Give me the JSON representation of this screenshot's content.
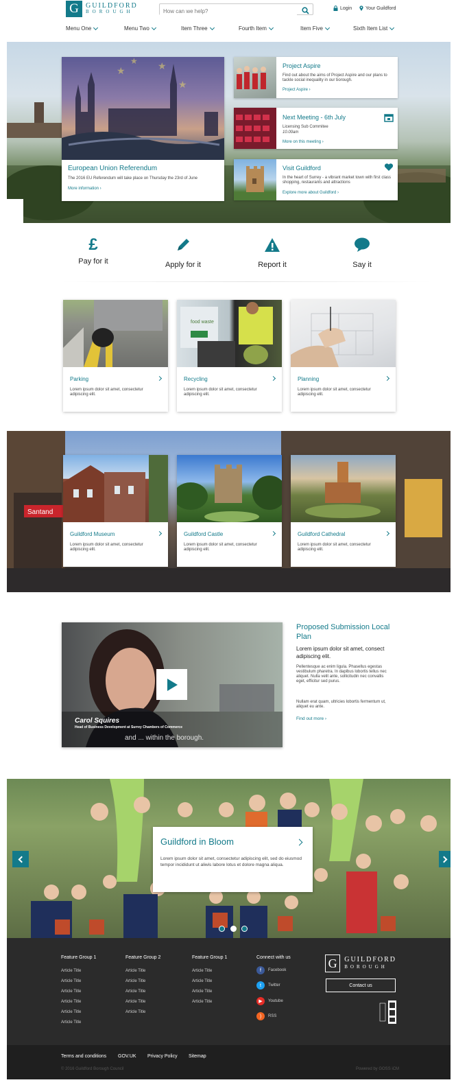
{
  "header": {
    "logo": {
      "line1": "GUILDFORD",
      "line2": "BOROUGH",
      "mark": "G"
    },
    "search_placeholder": "How can we help?",
    "login": "Login",
    "your_guildford": "Your Guildford"
  },
  "nav": [
    "Menu One",
    "Menu Two",
    "Item Three",
    "Fourth Item",
    "Item Five",
    "Sixth Item List"
  ],
  "hero": {
    "main": {
      "title": "European Union Referendum",
      "text": "The 2016 EU Referendum will take place on Thursday the 23rd of June",
      "link": "More information ›"
    },
    "side": [
      {
        "title": "Project Aspire",
        "text": "Find out about the aims of Project Aspire and our plans to tackle social inequality in our borough.",
        "link": "Project Aspire ›"
      },
      {
        "title": "Next Meeting - 6th July",
        "text": "Licensing Sub Commitee",
        "time": "10.00am",
        "link": "More on this meeting ›"
      },
      {
        "title": "Visit Guildford",
        "text": "In the heart of Surrey - a vibrant market town with first class shopping, restaurants and attractions",
        "link": "Explore more about Guildford ›"
      }
    ]
  },
  "tasks": [
    {
      "label": "Pay for it",
      "icon": "pound-icon"
    },
    {
      "label": "Apply for it",
      "icon": "pencil-icon"
    },
    {
      "label": "Report it",
      "icon": "warning-icon"
    },
    {
      "label": "Say it",
      "icon": "speech-bubble-icon"
    }
  ],
  "services": [
    {
      "title": "Parking",
      "text": "Lorem ipsum dolor sit amet, consectetur adipiscing elit."
    },
    {
      "title": "Recycling",
      "text": "Lorem ipsum dolor sit amet, consectetur adipiscing elit."
    },
    {
      "title": "Planning",
      "text": "Lorem ipsum dolor sit amet, consectetur adipiscing elit."
    }
  ],
  "places": [
    {
      "title": "Guildford Museum",
      "text": "Lorem ipsum dolor sit amet, consectetur adipiscing elit."
    },
    {
      "title": "Guildford Castle",
      "text": "Lorem ipsum dolor sit amet, consectetur adipiscing elit."
    },
    {
      "title": "Guildford Cathedral",
      "text": "Lorem ipsum dolor sit amet, consectetur adipiscing elit."
    }
  ],
  "video": {
    "name": "Carol Squires",
    "role": "Head of Business Development at Surrey Chambers of Commerce",
    "subtitle": "and ... within the borough."
  },
  "plan": {
    "title": "Proposed Submission Local Plan",
    "lead": "Lorem ipsum dolor sit amet, consect adipiscing elit.",
    "p1": "Pellentesque ac enim ligula. Phasellus egestas vestibulum pharetra. In dapibus lobortis tellus nec aliquet. Nulla velit ante, sollicitudin nec convallis eget, efficitur sed purus.",
    "p2": "Nullam erat quam, ultricies lobortis fermentum ut, aliquet eu ante.",
    "link": "Find out more ›"
  },
  "bloom": {
    "title": "Guildford in Bloom",
    "text": "Lorem ipsum dolor sit amet, consectetur adipiscing elit, sed do eiusmod tempor incididunt ut aliwis labore lotus et dolore magna aliqua."
  },
  "footer": {
    "groups": [
      {
        "title": "Feature Group 1",
        "items": [
          "Article Title",
          "Article Title",
          "Article Title",
          "Article Title",
          "Article Title",
          "Article Title"
        ]
      },
      {
        "title": "Feature Group 2",
        "items": [
          "Article Title",
          "Article Title",
          "Article Title",
          "Article Title",
          "Article Title"
        ]
      },
      {
        "title": "Feature Group 1",
        "items": [
          "Article Title",
          "Article Title",
          "Article Title",
          "Article Title"
        ]
      }
    ],
    "connect": {
      "title": "Connect with us",
      "items": [
        {
          "label": "Facebook",
          "color": "#3b5998",
          "icon": "facebook-icon"
        },
        {
          "label": "Twitter",
          "color": "#1da1f2",
          "icon": "twitter-icon"
        },
        {
          "label": "Youtube",
          "color": "#e52d27",
          "icon": "youtube-icon"
        },
        {
          "label": "RSS",
          "color": "#f26522",
          "icon": "rss-icon"
        }
      ]
    },
    "contact": "Contact us",
    "bottom_links": [
      "Terms and conditions",
      "GOV.UK",
      "Privacy Policy",
      "Sitemap"
    ],
    "copyright": "© 2016 Guildford Borough Council",
    "powered": "Powered by GOSS iCM"
  },
  "colors": {
    "accent": "#137a8a",
    "footer": "#2b2b2b",
    "footer_bottom": "#1f1f1f"
  }
}
